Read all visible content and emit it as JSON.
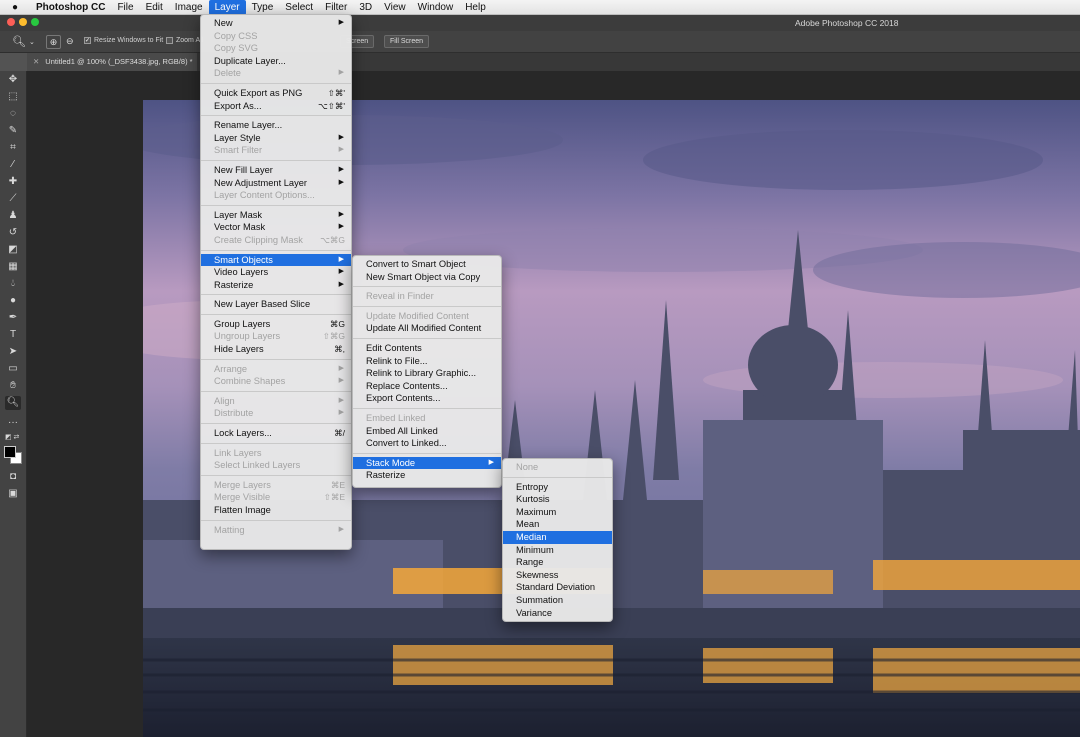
{
  "menubar": {
    "app": "Photoshop CC",
    "items": [
      "File",
      "Edit",
      "Image",
      "Layer",
      "Type",
      "Select",
      "Filter",
      "3D",
      "View",
      "Window",
      "Help"
    ]
  },
  "window": {
    "title": "Adobe Photoshop CC 2018"
  },
  "options_bar": {
    "resize_windows": "Resize Windows to Fit",
    "zoom_all": "Zoom All",
    "screen_btn": "Screen",
    "fill_screen": "Fill Screen"
  },
  "document_tab": {
    "label": "Untitled1 @ 100% (_DSF3438.jpg, RGB/8) *"
  },
  "layer_menu": {
    "new": "New",
    "copy_css": "Copy CSS",
    "copy_svg": "Copy SVG",
    "duplicate_layer": "Duplicate Layer...",
    "delete": "Delete",
    "quick_export": "Quick Export as PNG",
    "quick_export_sc": "⇧⌘'",
    "export_as": "Export As...",
    "export_as_sc": "⌥⇧⌘'",
    "rename_layer": "Rename Layer...",
    "layer_style": "Layer Style",
    "smart_filter": "Smart Filter",
    "new_fill_layer": "New Fill Layer",
    "new_adjustment_layer": "New Adjustment Layer",
    "layer_content_options": "Layer Content Options...",
    "layer_mask": "Layer Mask",
    "vector_mask": "Vector Mask",
    "create_clipping_mask": "Create Clipping Mask",
    "create_clipping_mask_sc": "⌥⌘G",
    "smart_objects": "Smart Objects",
    "video_layers": "Video Layers",
    "rasterize": "Rasterize",
    "new_layer_based_slice": "New Layer Based Slice",
    "group_layers": "Group Layers",
    "group_layers_sc": "⌘G",
    "ungroup_layers": "Ungroup Layers",
    "ungroup_layers_sc": "⇧⌘G",
    "hide_layers": "Hide Layers",
    "hide_layers_sc": "⌘,",
    "arrange": "Arrange",
    "combine_shapes": "Combine Shapes",
    "align": "Align",
    "distribute": "Distribute",
    "lock_layers": "Lock Layers...",
    "lock_layers_sc": "⌘/",
    "link_layers": "Link Layers",
    "select_linked_layers": "Select Linked Layers",
    "merge_layers": "Merge Layers",
    "merge_layers_sc": "⌘E",
    "merge_visible": "Merge Visible",
    "merge_visible_sc": "⇧⌘E",
    "flatten_image": "Flatten Image",
    "matting": "Matting"
  },
  "smart_objects_menu": {
    "convert": "Convert to Smart Object",
    "new_via_copy": "New Smart Object via Copy",
    "reveal_in_finder": "Reveal in Finder",
    "update_modified": "Update Modified Content",
    "update_all_modified": "Update All Modified Content",
    "edit_contents": "Edit Contents",
    "relink_to_file": "Relink to File...",
    "relink_to_library": "Relink to Library Graphic...",
    "replace_contents": "Replace Contents...",
    "export_contents": "Export Contents...",
    "embed_linked": "Embed Linked",
    "embed_all_linked": "Embed All Linked",
    "convert_to_linked": "Convert to Linked...",
    "stack_mode": "Stack Mode",
    "rasterize": "Rasterize"
  },
  "stack_mode_menu": {
    "none": "None",
    "items": [
      "Entropy",
      "Kurtosis",
      "Maximum",
      "Mean",
      "Median",
      "Minimum",
      "Range",
      "Skewness",
      "Standard Deviation",
      "Summation",
      "Variance"
    ],
    "selected": "Median"
  },
  "colors": {
    "highlight": "#1f6fe0",
    "menu_bg": "#e8e8e8"
  }
}
